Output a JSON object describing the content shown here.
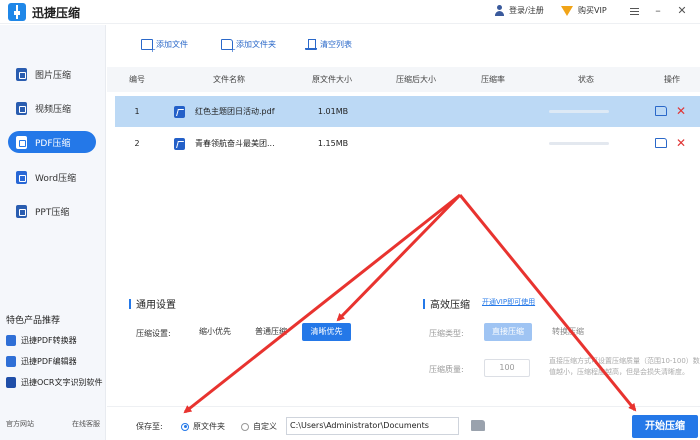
{
  "app": {
    "title": "迅捷压缩",
    "login_label": "登录/注册",
    "vip_label": "购买VIP",
    "window_buttons": [
      "menu",
      "minimize",
      "close"
    ]
  },
  "sidebar": {
    "items": [
      {
        "label": "图片压缩",
        "icon": "image-icon",
        "active": false
      },
      {
        "label": "视频压缩",
        "icon": "video-icon",
        "active": false
      },
      {
        "label": "PDF压缩",
        "icon": "pdf-icon",
        "active": true
      },
      {
        "label": "Word压缩",
        "icon": "word-icon",
        "active": false
      },
      {
        "label": "PPT压缩",
        "icon": "ppt-icon",
        "active": false
      }
    ],
    "featured_title": "特色产品推荐",
    "featured": [
      {
        "label": "迅捷PDF转换器",
        "icon": "pdf-converter-icon"
      },
      {
        "label": "迅捷PDF编辑器",
        "icon": "pdf-editor-icon"
      },
      {
        "label": "迅捷OCR文字识别软件",
        "icon": "ocr-icon"
      }
    ],
    "footer": {
      "website": "官方网站",
      "support": "在线客服"
    }
  },
  "toolbar": {
    "add_file": "添加文件",
    "add_folder": "添加文件夹",
    "clear_list": "清空列表"
  },
  "table": {
    "columns": [
      "编号",
      "文件名称",
      "原文件大小",
      "压缩后大小",
      "压缩率",
      "状态",
      "操作"
    ],
    "rows": [
      {
        "index": "1",
        "name": "红色主题团日活动.pdf",
        "size": "1.01MB",
        "compressed": "",
        "ratio": "",
        "selected": true
      },
      {
        "index": "2",
        "name": "青春领航奋斗最美团...",
        "size": "1.15MB",
        "compressed": "",
        "ratio": "",
        "selected": false
      }
    ]
  },
  "settings": {
    "general_title": "通用设置",
    "compress_label": "压缩设置:",
    "options": [
      "缩小优先",
      "普通压缩",
      "清晰优先"
    ],
    "selected_option": "清晰优先",
    "advanced_title": "高效压缩",
    "vip_link": "开通VIP即可使用",
    "type_label": "压缩类型:",
    "type_options": [
      "直接压缩",
      "转换压缩"
    ],
    "quality_label": "压缩质量:",
    "quality_value": "100",
    "tip": "直接压缩方式可设置压缩质量（范围10-100）数值越小，压缩程度越高，但是会损失清晰度。"
  },
  "save": {
    "label": "保存至:",
    "original_folder": "原文件夹",
    "custom": "自定义",
    "path": "C:\\Users\\Administrator\\Documents",
    "start_button": "开始压缩"
  },
  "colors": {
    "accent": "#2478e8",
    "selected_row": "#bcd9f5",
    "danger": "#e03535",
    "annotation_arrow": "#e8332f"
  }
}
